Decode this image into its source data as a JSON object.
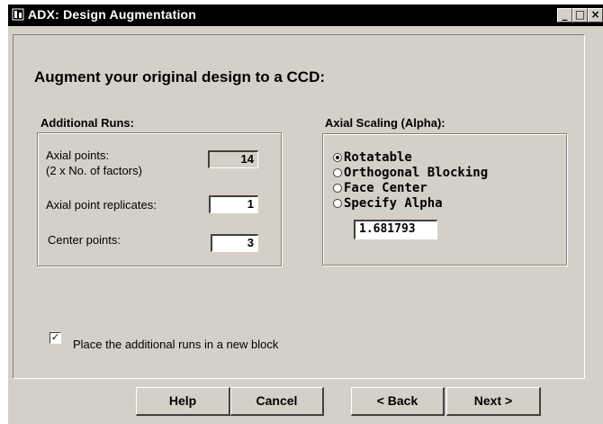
{
  "window": {
    "title": "ADX: Design Augmentation",
    "buttons": {
      "minimize": "_",
      "maximize": "□",
      "close": "×"
    }
  },
  "heading": "Augment your original design to a CCD:",
  "additional_runs": {
    "title": "Additional Runs:",
    "axial_points_label_1": "Axial points:",
    "axial_points_label_2": "(2 x No. of factors)",
    "axial_points_value": "14",
    "axial_replicates_label": "Axial point replicates:",
    "axial_replicates_value": "1",
    "center_points_label": "Center points:",
    "center_points_value": "3"
  },
  "axial_scaling": {
    "title": "Axial Scaling (Alpha):",
    "options": [
      "Rotatable",
      "Orthogonal Blocking",
      "Face Center",
      "Specify Alpha"
    ],
    "selected": "Rotatable",
    "alpha_value": "1.681793"
  },
  "new_block": {
    "checked": true,
    "label": "Place the additional runs in a new block"
  },
  "buttons": {
    "help": "Help",
    "cancel": "Cancel",
    "back": "< Back",
    "next": "Next >"
  }
}
